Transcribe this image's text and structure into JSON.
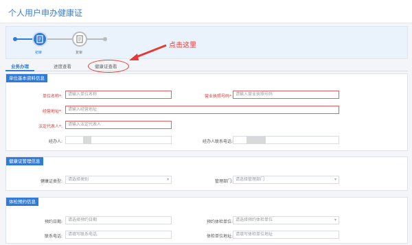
{
  "window": {
    "title": "个人用户申办健康证"
  },
  "steps": [
    {
      "label": "初审"
    },
    {
      "label": "复审"
    }
  ],
  "tabs": [
    {
      "label": "业务办理"
    },
    {
      "label": "进度查看"
    },
    {
      "label": "健康证查看"
    }
  ],
  "annotation": {
    "text": "点击这里"
  },
  "section_basic": {
    "title": "单位基本资料信息",
    "unit_name": {
      "label": "单位名称*:",
      "placeholder": "请输入单位名称"
    },
    "business_license": {
      "label": "营业执照号码*:",
      "placeholder": "请输入营业执照号码"
    },
    "address": {
      "label": "经营地址*:",
      "placeholder": "请输入经营地址"
    },
    "legal_rep": {
      "label": "法定代表人*:",
      "placeholder": "请输入法定代表人"
    },
    "handler": {
      "label": "经办人:"
    },
    "handler_phone": {
      "label": "经办人联系电话:"
    }
  },
  "section_health": {
    "title": "健康证管理信息",
    "cert_type": {
      "label": "健康证类型:",
      "placeholder": "请选择类别"
    },
    "dept": {
      "label": "管理部门:",
      "placeholder": "请选择管理部门"
    }
  },
  "section_exam": {
    "title": "体检预约信息",
    "appt_date": {
      "label": "预约日期:",
      "placeholder": "请选择预约日期"
    },
    "exam_unit": {
      "label": "预约体检单位:",
      "placeholder": "请选择预约体检单位"
    },
    "phone": {
      "label": "联系电话:",
      "placeholder": "请填写联系电话"
    },
    "exam_address": {
      "label": "体检单位地址:",
      "placeholder": "请填写体检单位地址"
    }
  }
}
